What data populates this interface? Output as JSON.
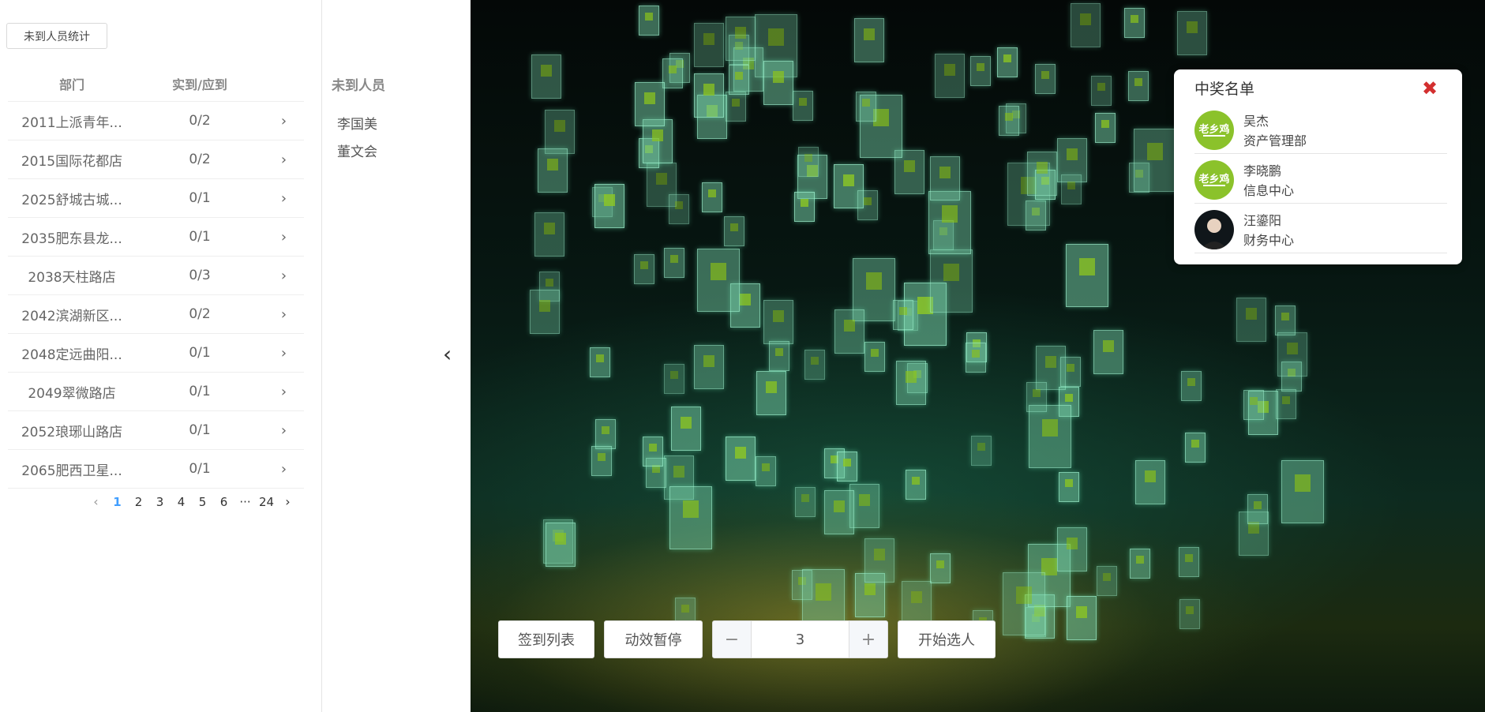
{
  "left": {
    "stats_button": "未到人员统计",
    "headers": {
      "dept": "部门",
      "ratio": "实到/应到"
    },
    "rows": [
      {
        "dept": "2011上派青年...",
        "ratio": "0/2"
      },
      {
        "dept": "2015国际花都店",
        "ratio": "0/2"
      },
      {
        "dept": "2025舒城古城...",
        "ratio": "0/1"
      },
      {
        "dept": "2035肥东县龙...",
        "ratio": "0/1"
      },
      {
        "dept": "2038天柱路店",
        "ratio": "0/3"
      },
      {
        "dept": "2042滨湖新区...",
        "ratio": "0/2"
      },
      {
        "dept": "2048定远曲阳...",
        "ratio": "0/1"
      },
      {
        "dept": "2049翠微路店",
        "ratio": "0/1"
      },
      {
        "dept": "2052琅琊山路店",
        "ratio": "0/1"
      },
      {
        "dept": "2065肥西卫星...",
        "ratio": "0/1"
      }
    ],
    "pagination": {
      "pages": [
        "1",
        "2",
        "3",
        "4",
        "5",
        "6",
        "···",
        "24"
      ],
      "current": "1"
    }
  },
  "absent": {
    "title": "未到人员",
    "names": [
      "李国美",
      "董文会"
    ]
  },
  "controls": {
    "signin_list": "签到列表",
    "pause_effect": "动效暂停",
    "count_value": "3",
    "minus": "−",
    "plus": "+",
    "start_select": "开始选人"
  },
  "winners": {
    "title": "中奖名单",
    "list": [
      {
        "name": "吴杰",
        "dept": "资产管理部",
        "avatar": "logo"
      },
      {
        "name": "李晓鹏",
        "dept": "信息中心",
        "avatar": "logo"
      },
      {
        "name": "汪鎏阳",
        "dept": "财务中心",
        "avatar": "photo"
      }
    ]
  },
  "colors": {
    "accent": "#409eff",
    "brand_green": "#8bc22b",
    "close_red": "#d32f2f"
  }
}
